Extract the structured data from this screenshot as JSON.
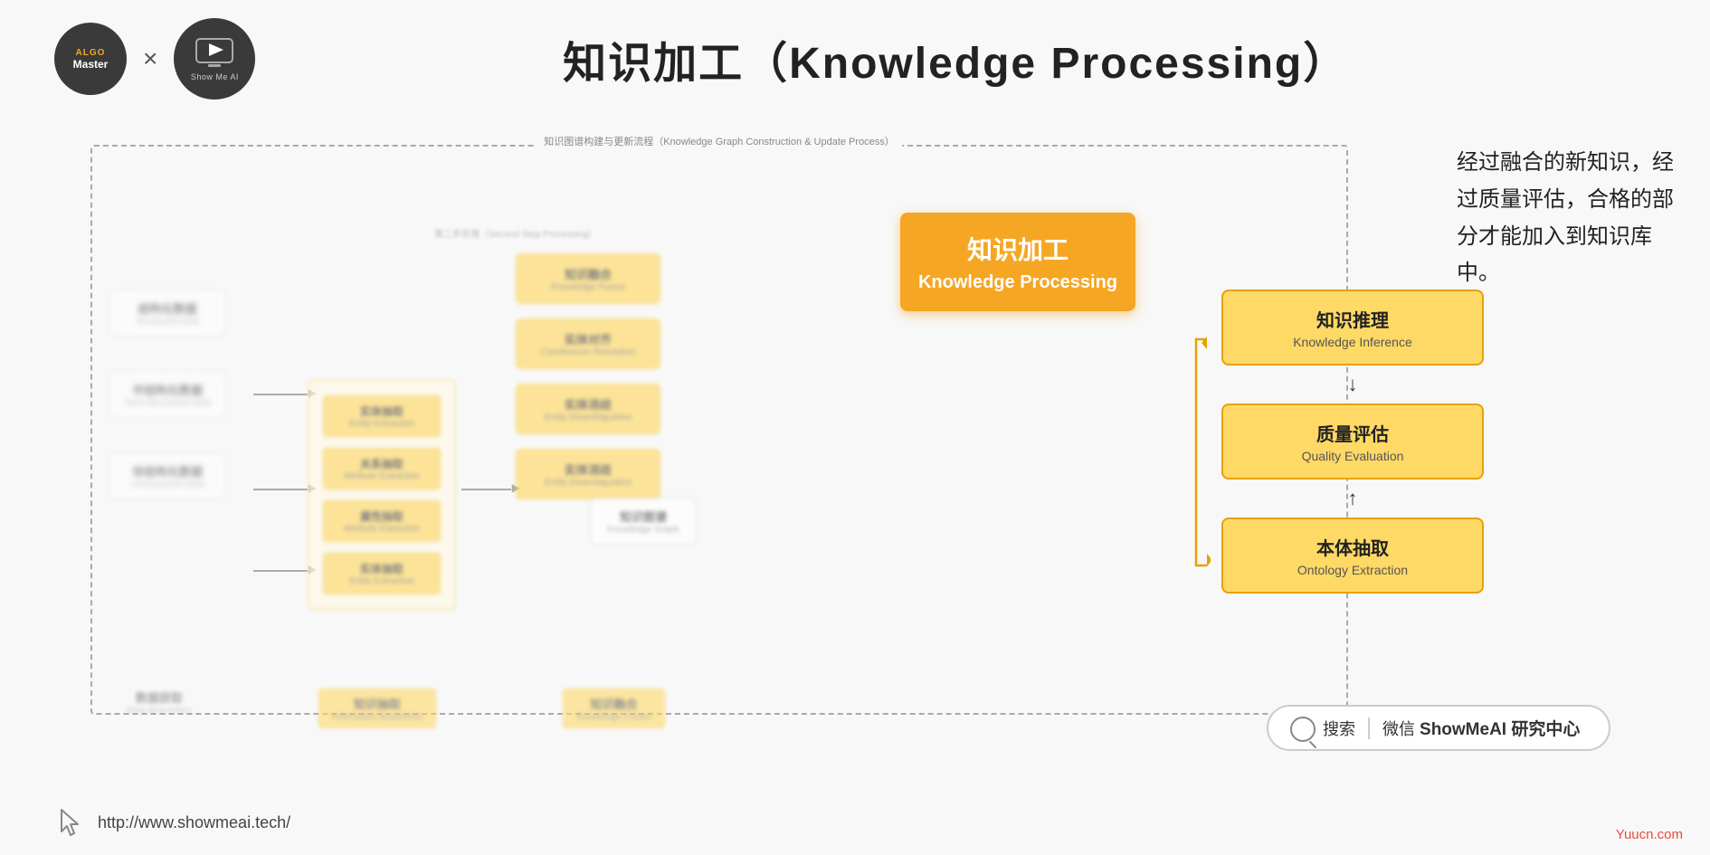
{
  "header": {
    "title": "知识加工（Knowledge Processing）",
    "logo_algo": "ALGO",
    "logo_master": "Master",
    "logo_showme": "Show Me AI",
    "x_separator": "×"
  },
  "diagram": {
    "kg_title": "知识图谱构建与更新流程（Knowledge Graph Construction & Update Process）",
    "kg_subtitle": "第二步处理（Second Step Processing）",
    "focus": {
      "main_box_cn": "知识加工",
      "main_box_en": "Knowledge Processing",
      "sub_boxes": [
        {
          "cn": "知识推理",
          "en": "Knowledge Inference"
        },
        {
          "cn": "质量评估",
          "en": "Quality Evaluation"
        },
        {
          "cn": "本体抽取",
          "en": "Ontology Extraction"
        }
      ],
      "description": "经过融合的新知识，经过质量评估，合格的部分才能加入到知识库中。"
    },
    "data_sources": [
      {
        "cn": "结构化数据",
        "en": "Structured Data"
      },
      {
        "cn": "半结构化数据",
        "en": "Semi-Structured Data"
      },
      {
        "cn": "非结构化数据",
        "en": "Unstructured Data"
      }
    ],
    "extraction_boxes": [
      {
        "cn": "实体抽取",
        "en": "Entity Extraction"
      },
      {
        "cn": "关系抽取",
        "en": "Attribute Extraction"
      },
      {
        "cn": "属性抽取",
        "en": "Entity Extraction"
      }
    ],
    "middle_boxes": [
      {
        "cn": "知识融合",
        "en": "Knowledge Fusion"
      },
      {
        "cn": "实体对齐",
        "en": "Coreference Resolution"
      },
      {
        "cn": "实体消歧",
        "en": "Entity Disambiguation"
      }
    ],
    "bottom_items": [
      {
        "cn": "数据获取",
        "en": "Data Acquisition"
      },
      {
        "cn": "知识抽取",
        "en": "Information Acquisition",
        "highlight": true
      },
      {
        "cn": "知识融合",
        "en": "Knowledge Fusion",
        "highlight": true
      }
    ],
    "kg_right": {
      "cn": "知识图谱",
      "en": "Knowledge Graph"
    }
  },
  "search_bar": {
    "icon": "search-icon",
    "text": "搜索",
    "divider": "|",
    "label": "微信",
    "brand": "ShowMeAI 研究中心"
  },
  "footer": {
    "url": "http://www.showmeai.tech/",
    "watermark": "Yuucn.com"
  }
}
